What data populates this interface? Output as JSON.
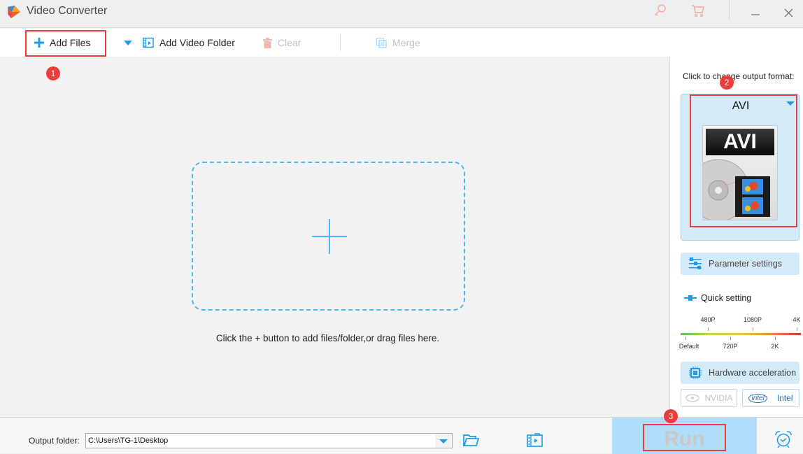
{
  "titlebar": {
    "title": "Video Converter",
    "icons": [
      "app-logo",
      "key-icon",
      "cart-icon",
      "minimize-icon",
      "close-icon"
    ]
  },
  "toolbar": {
    "add_files": "Add Files",
    "add_video_folder": "Add Video Folder",
    "clear": "Clear",
    "merge": "Merge"
  },
  "annotations": {
    "step1": "1",
    "step2": "2",
    "step3": "3"
  },
  "main": {
    "hint": "Click the + button to add files/folder,or drag files here."
  },
  "right_panel": {
    "format_prompt": "Click to change output format:",
    "format_name": "AVI",
    "format_image_label": "AVI",
    "parameter_settings": "Parameter settings",
    "quick_setting": "Quick setting",
    "quality_top_labels": [
      "480P",
      "1080P",
      "4K"
    ],
    "quality_bottom_labels": [
      "Default",
      "720P",
      "2K"
    ],
    "hardware_acceleration": "Hardware acceleration",
    "nvidia": "NVIDIA",
    "intel": "Intel",
    "intel_logo": "intel"
  },
  "bottom": {
    "output_label": "Output folder:",
    "output_path": "C:\\Users\\TG-1\\Desktop",
    "run": "Run"
  },
  "colors": {
    "accent": "#1d9be8",
    "highlight": "#ee3b3b",
    "card_bg": "#d3ebf9",
    "run_bg": "#b0ddf9"
  }
}
